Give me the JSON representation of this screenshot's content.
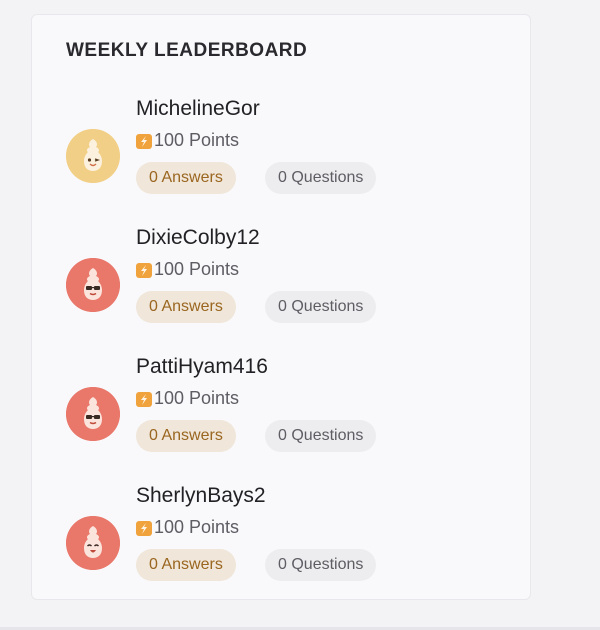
{
  "leaderboard": {
    "title": "WEEKLY LEADERBOARD",
    "users": [
      {
        "name": "MichelineGor",
        "points": "100 Points",
        "answers": "0 Answers",
        "questions": "0 Questions",
        "avatar_color": "#f2cf86",
        "avatar": "smiling-onion-avatar"
      },
      {
        "name": "DixieColby12",
        "points": "100 Points",
        "answers": "0 Answers",
        "questions": "0 Questions",
        "avatar_color": "#e9776a",
        "avatar": "sunglasses-onion-avatar"
      },
      {
        "name": "PattiHyam416",
        "points": "100 Points",
        "answers": "0 Answers",
        "questions": "0 Questions",
        "avatar_color": "#e9776a",
        "avatar": "sunglasses-onion-avatar"
      },
      {
        "name": "SherlynBays2",
        "points": "100 Points",
        "answers": "0 Answers",
        "questions": "0 Questions",
        "avatar_color": "#e9776a",
        "avatar": "happy-onion-avatar"
      }
    ]
  },
  "colors": {
    "answers_pill_bg": "#f0e6d9",
    "answers_pill_text": "#9a6620",
    "questions_pill_bg": "#ededef",
    "points_icon": "#f0a33c"
  }
}
